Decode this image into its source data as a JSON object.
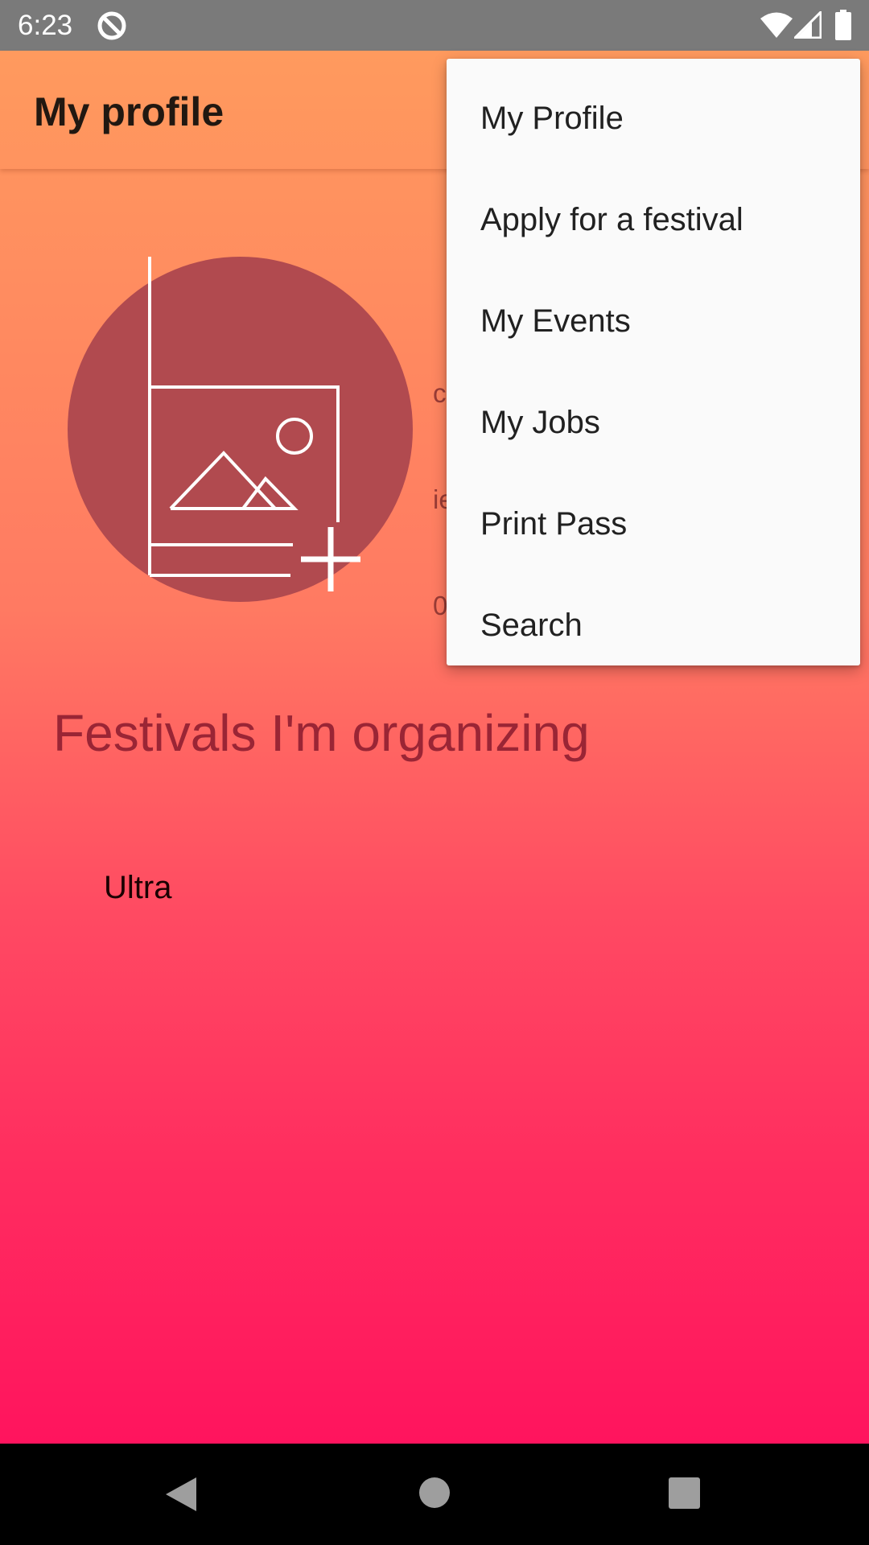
{
  "status_bar": {
    "time": "6:23",
    "icons": [
      "sync-disabled-icon",
      "wifi-icon",
      "signal-icon",
      "battery-icon"
    ]
  },
  "toolbar": {
    "title": "My profile"
  },
  "profile": {
    "avatar_icon": "add-photo-icon",
    "info_line_1": "c",
    "info_line_2": "ie",
    "info_line_3": "0"
  },
  "section": {
    "title": "Festivals I'm organizing"
  },
  "festivals": [
    {
      "name": "Ultra"
    }
  ],
  "menu": {
    "items": [
      {
        "label": "My Profile"
      },
      {
        "label": "Apply for a festival"
      },
      {
        "label": "My Events"
      },
      {
        "label": "My Jobs"
      },
      {
        "label": "Print Pass"
      },
      {
        "label": "Search"
      }
    ]
  },
  "nav_bar": {
    "icons": [
      "back-icon",
      "home-icon",
      "recents-icon"
    ]
  },
  "colors": {
    "gradient_top": "#ff9a5e",
    "gradient_bottom": "#ff145e",
    "avatar_fill": "#b14a4f",
    "section_title": "#9a2535",
    "menu_background": "#fafafa"
  }
}
